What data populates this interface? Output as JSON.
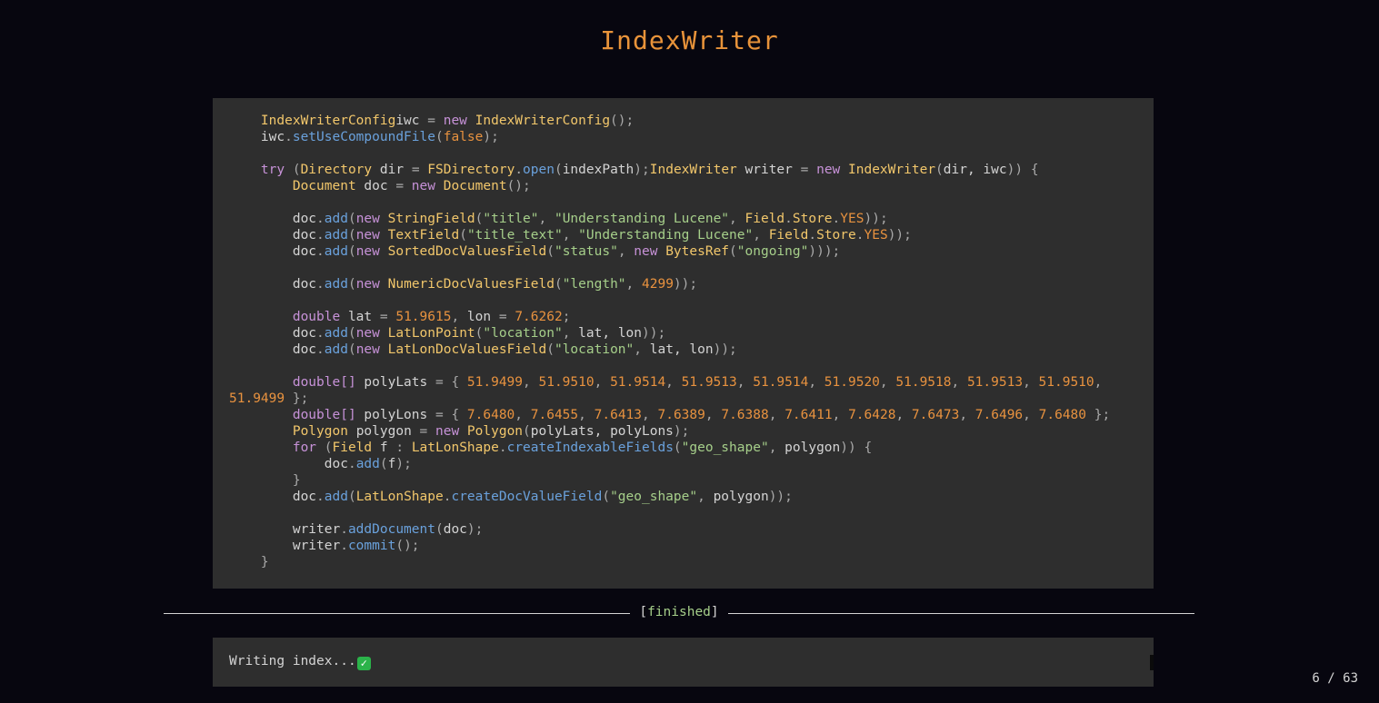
{
  "slide": {
    "title": "IndexWriter",
    "page_indicator": "6 / 63"
  },
  "code_lines": [
    [
      [
        "t",
        "    IndexWriterConfig"
      ],
      [
        "",
        "iwc "
      ],
      [
        "p",
        "= "
      ],
      [
        "k",
        "new "
      ],
      [
        "t",
        "IndexWriterConfig"
      ],
      [
        "p",
        "();"
      ]
    ],
    [
      [
        "",
        "    iwc"
      ],
      [
        "p",
        "."
      ],
      [
        "m",
        "setUseCompoundFile"
      ],
      [
        "p",
        "("
      ],
      [
        "n",
        "false"
      ],
      [
        "p",
        ");"
      ]
    ],
    [],
    [
      [
        "k",
        "    try "
      ],
      [
        "p",
        "("
      ],
      [
        "t",
        "Directory "
      ],
      [
        "",
        "dir "
      ],
      [
        "p",
        "= "
      ],
      [
        "t",
        "FSDirectory"
      ],
      [
        "p",
        "."
      ],
      [
        "m",
        "open"
      ],
      [
        "p",
        "("
      ],
      [
        "",
        "indexPath"
      ],
      [
        "p",
        ");"
      ],
      [
        "t",
        "IndexWriter "
      ],
      [
        "",
        "writer "
      ],
      [
        "p",
        "= "
      ],
      [
        "k",
        "new "
      ],
      [
        "t",
        "IndexWriter"
      ],
      [
        "p",
        "("
      ],
      [
        "",
        "dir, iwc"
      ],
      [
        "p",
        ")) {"
      ]
    ],
    [
      [
        "t",
        "        Document "
      ],
      [
        "",
        "doc "
      ],
      [
        "p",
        "= "
      ],
      [
        "k",
        "new "
      ],
      [
        "t",
        "Document"
      ],
      [
        "p",
        "();"
      ]
    ],
    [],
    [
      [
        "",
        "        doc"
      ],
      [
        "p",
        "."
      ],
      [
        "m",
        "add"
      ],
      [
        "p",
        "("
      ],
      [
        "k",
        "new "
      ],
      [
        "t",
        "StringField"
      ],
      [
        "p",
        "("
      ],
      [
        "s",
        "\"title\""
      ],
      [
        "p",
        ", "
      ],
      [
        "s",
        "\"Understanding Lucene\""
      ],
      [
        "p",
        ", "
      ],
      [
        "t",
        "Field"
      ],
      [
        "p",
        "."
      ],
      [
        "t",
        "Store"
      ],
      [
        "p",
        "."
      ],
      [
        "n",
        "YES"
      ],
      [
        "p",
        "));"
      ]
    ],
    [
      [
        "",
        "        doc"
      ],
      [
        "p",
        "."
      ],
      [
        "m",
        "add"
      ],
      [
        "p",
        "("
      ],
      [
        "k",
        "new "
      ],
      [
        "t",
        "TextField"
      ],
      [
        "p",
        "("
      ],
      [
        "s",
        "\"title_text\""
      ],
      [
        "p",
        ", "
      ],
      [
        "s",
        "\"Understanding Lucene\""
      ],
      [
        "p",
        ", "
      ],
      [
        "t",
        "Field"
      ],
      [
        "p",
        "."
      ],
      [
        "t",
        "Store"
      ],
      [
        "p",
        "."
      ],
      [
        "n",
        "YES"
      ],
      [
        "p",
        "));"
      ]
    ],
    [
      [
        "",
        "        doc"
      ],
      [
        "p",
        "."
      ],
      [
        "m",
        "add"
      ],
      [
        "p",
        "("
      ],
      [
        "k",
        "new "
      ],
      [
        "t",
        "SortedDocValuesField"
      ],
      [
        "p",
        "("
      ],
      [
        "s",
        "\"status\""
      ],
      [
        "p",
        ", "
      ],
      [
        "k",
        "new "
      ],
      [
        "t",
        "BytesRef"
      ],
      [
        "p",
        "("
      ],
      [
        "s",
        "\"ongoing\""
      ],
      [
        "p",
        ")));"
      ]
    ],
    [],
    [
      [
        "",
        "        doc"
      ],
      [
        "p",
        "."
      ],
      [
        "m",
        "add"
      ],
      [
        "p",
        "("
      ],
      [
        "k",
        "new "
      ],
      [
        "t",
        "NumericDocValuesField"
      ],
      [
        "p",
        "("
      ],
      [
        "s",
        "\"length\""
      ],
      [
        "p",
        ", "
      ],
      [
        "n",
        "4299"
      ],
      [
        "p",
        "));"
      ]
    ],
    [],
    [
      [
        "k",
        "        double "
      ],
      [
        "",
        "lat "
      ],
      [
        "p",
        "= "
      ],
      [
        "n",
        "51.9615"
      ],
      [
        "p",
        ", "
      ],
      [
        "",
        "lon "
      ],
      [
        "p",
        "= "
      ],
      [
        "n",
        "7.6262"
      ],
      [
        "p",
        ";"
      ]
    ],
    [
      [
        "",
        "        doc"
      ],
      [
        "p",
        "."
      ],
      [
        "m",
        "add"
      ],
      [
        "p",
        "("
      ],
      [
        "k",
        "new "
      ],
      [
        "t",
        "LatLonPoint"
      ],
      [
        "p",
        "("
      ],
      [
        "s",
        "\"location\""
      ],
      [
        "p",
        ", "
      ],
      [
        "",
        "lat, lon"
      ],
      [
        "p",
        "));"
      ]
    ],
    [
      [
        "",
        "        doc"
      ],
      [
        "p",
        "."
      ],
      [
        "m",
        "add"
      ],
      [
        "p",
        "("
      ],
      [
        "k",
        "new "
      ],
      [
        "t",
        "LatLonDocValuesField"
      ],
      [
        "p",
        "("
      ],
      [
        "s",
        "\"location\""
      ],
      [
        "p",
        ", "
      ],
      [
        "",
        "lat, lon"
      ],
      [
        "p",
        "));"
      ]
    ],
    [],
    [
      [
        "k",
        "        double[] "
      ],
      [
        "",
        "polyLats "
      ],
      [
        "p",
        "= { "
      ],
      [
        "n",
        "51.9499"
      ],
      [
        "p",
        ", "
      ],
      [
        "n",
        "51.9510"
      ],
      [
        "p",
        ", "
      ],
      [
        "n",
        "51.9514"
      ],
      [
        "p",
        ", "
      ],
      [
        "n",
        "51.9513"
      ],
      [
        "p",
        ", "
      ],
      [
        "n",
        "51.9514"
      ],
      [
        "p",
        ", "
      ],
      [
        "n",
        "51.9520"
      ],
      [
        "p",
        ", "
      ],
      [
        "n",
        "51.9518"
      ],
      [
        "p",
        ", "
      ],
      [
        "n",
        "51.9513"
      ],
      [
        "p",
        ", "
      ],
      [
        "n",
        "51.9510"
      ],
      [
        "p",
        ","
      ]
    ],
    [
      [
        "n",
        "51.9499"
      ],
      [
        "p",
        " };"
      ]
    ],
    [
      [
        "k",
        "        double[] "
      ],
      [
        "",
        "polyLons "
      ],
      [
        "p",
        "= { "
      ],
      [
        "n",
        "7.6480"
      ],
      [
        "p",
        ", "
      ],
      [
        "n",
        "7.6455"
      ],
      [
        "p",
        ", "
      ],
      [
        "n",
        "7.6413"
      ],
      [
        "p",
        ", "
      ],
      [
        "n",
        "7.6389"
      ],
      [
        "p",
        ", "
      ],
      [
        "n",
        "7.6388"
      ],
      [
        "p",
        ", "
      ],
      [
        "n",
        "7.6411"
      ],
      [
        "p",
        ", "
      ],
      [
        "n",
        "7.6428"
      ],
      [
        "p",
        ", "
      ],
      [
        "n",
        "7.6473"
      ],
      [
        "p",
        ", "
      ],
      [
        "n",
        "7.6496"
      ],
      [
        "p",
        ", "
      ],
      [
        "n",
        "7.6480"
      ],
      [
        "p",
        " };"
      ]
    ],
    [
      [
        "t",
        "        Polygon "
      ],
      [
        "",
        "polygon "
      ],
      [
        "p",
        "= "
      ],
      [
        "k",
        "new "
      ],
      [
        "t",
        "Polygon"
      ],
      [
        "p",
        "("
      ],
      [
        "",
        "polyLats, polyLons"
      ],
      [
        "p",
        ");"
      ]
    ],
    [
      [
        "k",
        "        for "
      ],
      [
        "p",
        "("
      ],
      [
        "t",
        "Field "
      ],
      [
        "",
        "f "
      ],
      [
        "p",
        ": "
      ],
      [
        "t",
        "LatLonShape"
      ],
      [
        "p",
        "."
      ],
      [
        "m",
        "createIndexableFields"
      ],
      [
        "p",
        "("
      ],
      [
        "s",
        "\"geo_shape\""
      ],
      [
        "p",
        ", "
      ],
      [
        "",
        "polygon"
      ],
      [
        "p",
        ")) {"
      ]
    ],
    [
      [
        "",
        "            doc"
      ],
      [
        "p",
        "."
      ],
      [
        "m",
        "add"
      ],
      [
        "p",
        "("
      ],
      [
        "",
        "f"
      ],
      [
        "p",
        ");"
      ]
    ],
    [
      [
        "p",
        "        }"
      ]
    ],
    [
      [
        "",
        "        doc"
      ],
      [
        "p",
        "."
      ],
      [
        "m",
        "add"
      ],
      [
        "p",
        "("
      ],
      [
        "t",
        "LatLonShape"
      ],
      [
        "p",
        "."
      ],
      [
        "m",
        "createDocValueField"
      ],
      [
        "p",
        "("
      ],
      [
        "s",
        "\"geo_shape\""
      ],
      [
        "p",
        ", "
      ],
      [
        "",
        "polygon"
      ],
      [
        "p",
        "));"
      ]
    ],
    [],
    [
      [
        "",
        "        writer"
      ],
      [
        "p",
        "."
      ],
      [
        "m",
        "addDocument"
      ],
      [
        "p",
        "("
      ],
      [
        "",
        "doc"
      ],
      [
        "p",
        ");"
      ]
    ],
    [
      [
        "",
        "        writer"
      ],
      [
        "p",
        "."
      ],
      [
        "m",
        "commit"
      ],
      [
        "p",
        "();"
      ]
    ],
    [
      [
        "p",
        "    }"
      ]
    ]
  ],
  "divider": {
    "open_bracket": "[",
    "label": "finished",
    "close_bracket": "]"
  },
  "output": {
    "text": "Writing index...",
    "check_icon": "check-mark-icon",
    "check_glyph": "✓",
    "check_color": "#2bb34a"
  },
  "colors": {
    "background": "#07060f",
    "code_background": "#2e2e2e",
    "title": "#e8933a",
    "type": "#f2c76b",
    "keyword": "#c792d8",
    "method": "#6aa1dc",
    "string": "#a6cf8a",
    "number": "#e8923f"
  }
}
